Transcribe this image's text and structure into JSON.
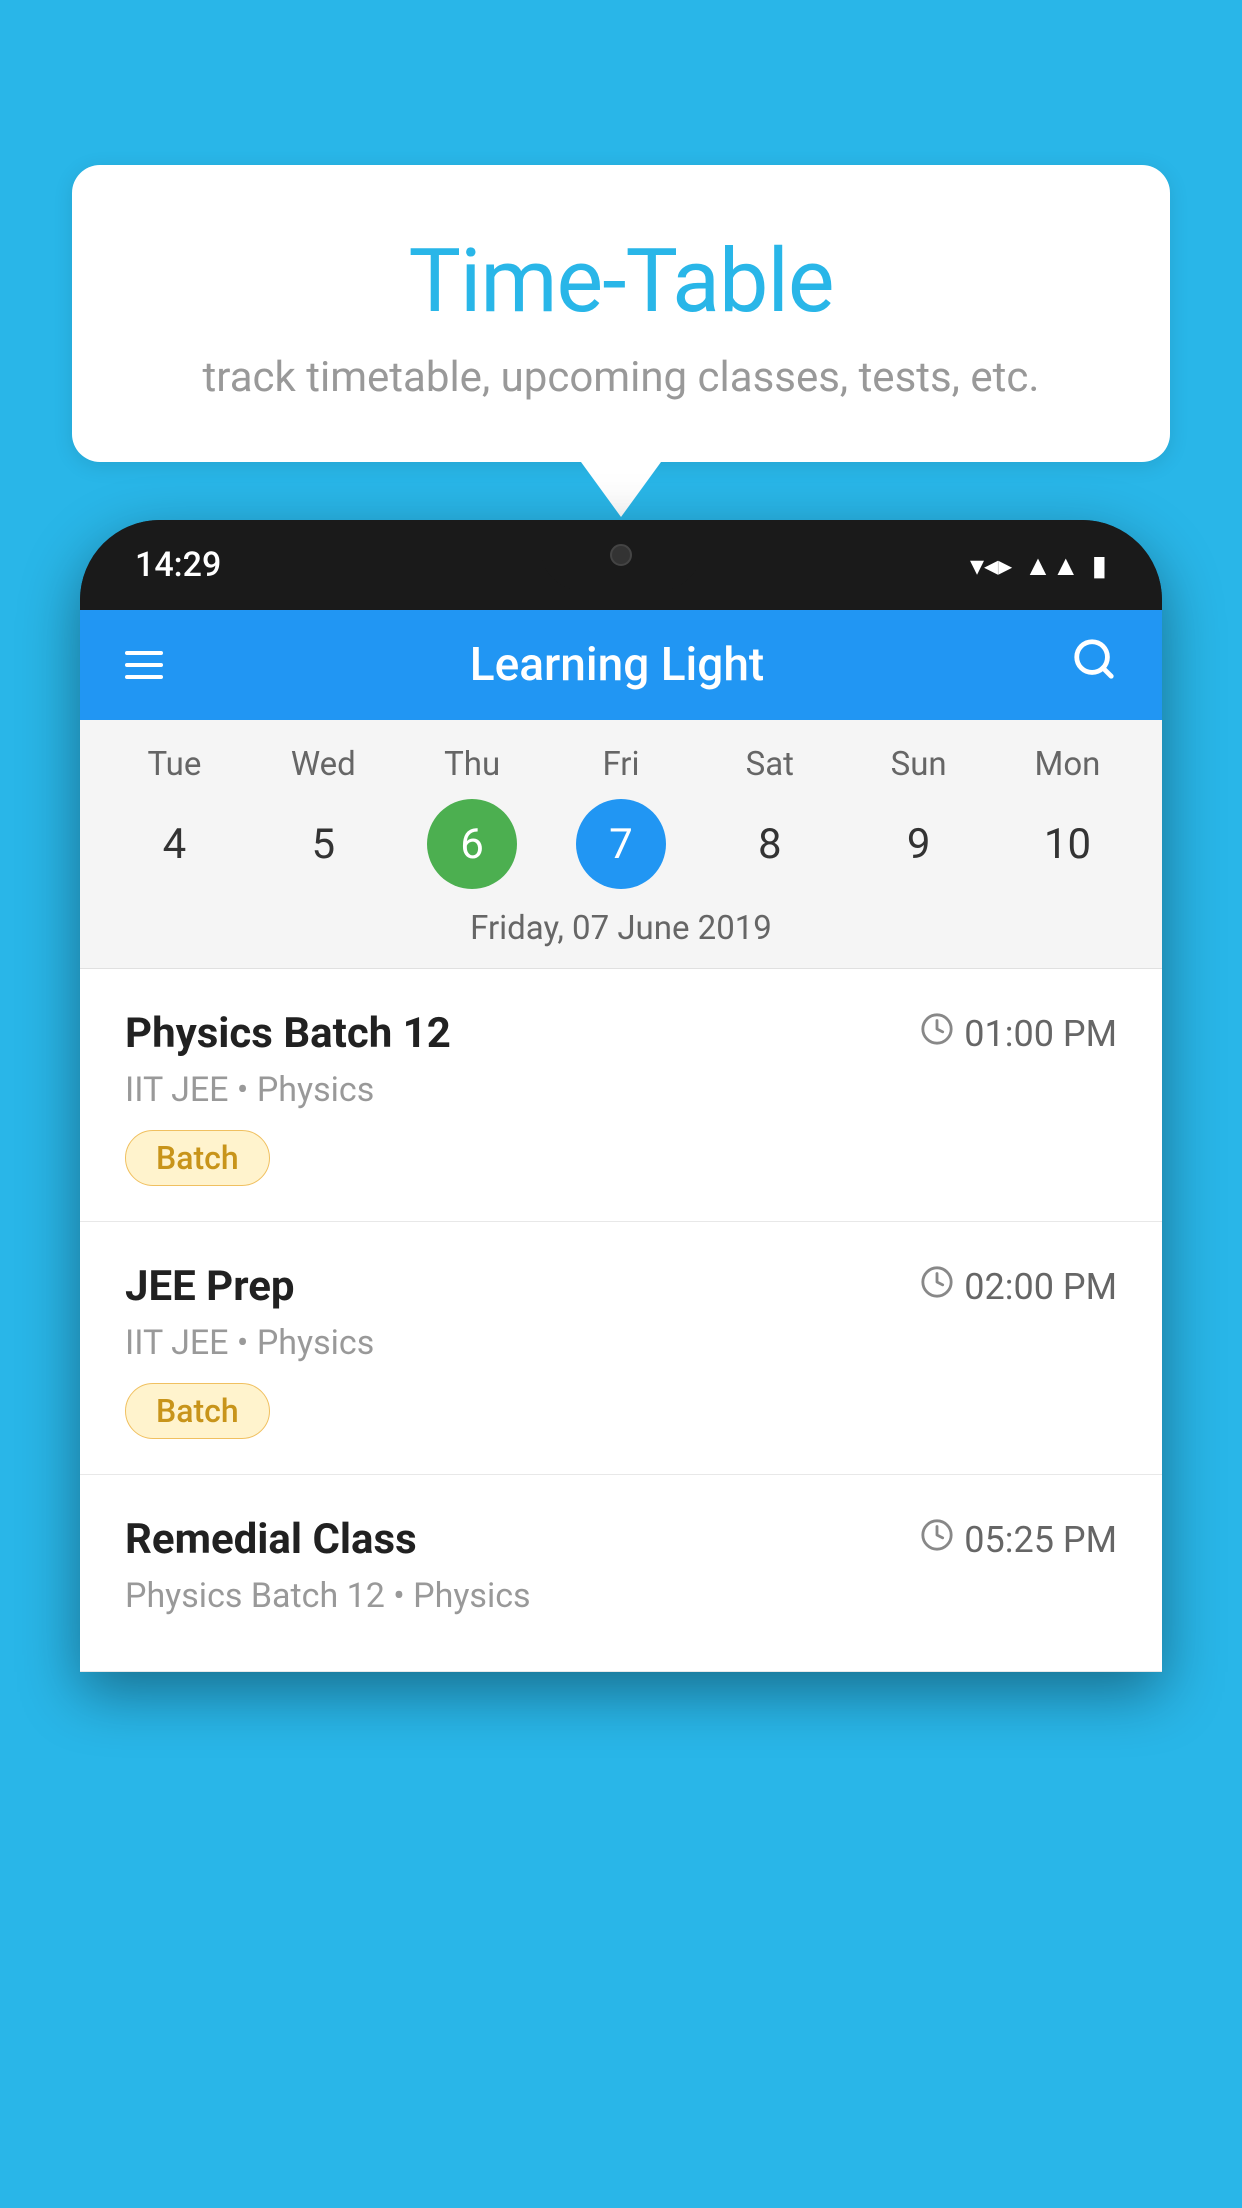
{
  "background": {
    "color": "#29b6e8"
  },
  "speech_bubble": {
    "title": "Time-Table",
    "subtitle": "track timetable, upcoming classes, tests, etc."
  },
  "phone": {
    "status_bar": {
      "time": "14:29"
    },
    "app_bar": {
      "title": "Learning Light"
    },
    "calendar": {
      "days": [
        {
          "label": "Tue",
          "number": "4",
          "state": "normal"
        },
        {
          "label": "Wed",
          "number": "5",
          "state": "normal"
        },
        {
          "label": "Thu",
          "number": "6",
          "state": "today"
        },
        {
          "label": "Fri",
          "number": "7",
          "state": "selected"
        },
        {
          "label": "Sat",
          "number": "8",
          "state": "normal"
        },
        {
          "label": "Sun",
          "number": "9",
          "state": "normal"
        },
        {
          "label": "Mon",
          "number": "10",
          "state": "normal"
        }
      ],
      "selected_date_label": "Friday, 07 June 2019"
    },
    "schedule": [
      {
        "title": "Physics Batch 12",
        "time": "01:00 PM",
        "subtitle": "IIT JEE • Physics",
        "badge": "Batch"
      },
      {
        "title": "JEE Prep",
        "time": "02:00 PM",
        "subtitle": "IIT JEE • Physics",
        "badge": "Batch"
      },
      {
        "title": "Remedial Class",
        "time": "05:25 PM",
        "subtitle": "Physics Batch 12 • Physics",
        "badge": null
      }
    ]
  }
}
